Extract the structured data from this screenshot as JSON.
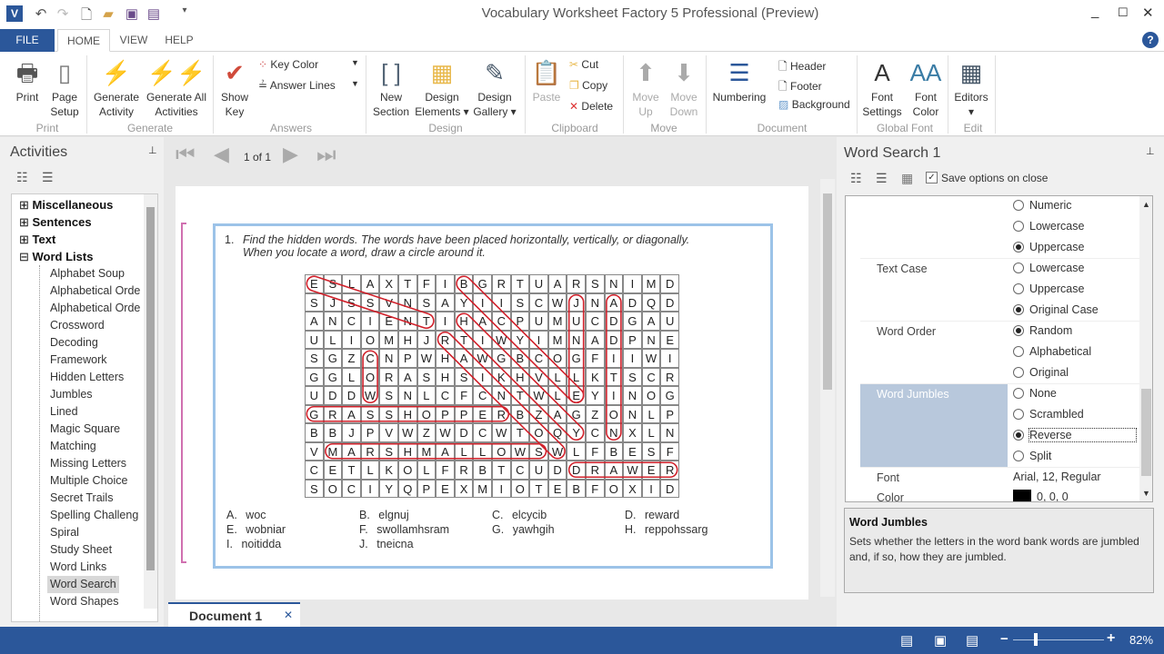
{
  "app": {
    "title": "Vocabulary Worksheet Factory 5 Professional (Preview)",
    "logo": "V"
  },
  "quick_access": [
    "undo-icon",
    "redo-icon",
    "new-icon",
    "open-icon",
    "save-icon",
    "save-as-icon",
    "customize-icon"
  ],
  "tabs": [
    {
      "label": "FILE"
    },
    {
      "label": "HOME",
      "active": true
    },
    {
      "label": "VIEW"
    },
    {
      "label": "HELP"
    }
  ],
  "ribbon": {
    "print": {
      "label": "Print",
      "group": "Print",
      "page_setup": "Page Setup"
    },
    "generate": {
      "activity": "Generate Activity",
      "all": "Generate All Activities",
      "group": "Generate"
    },
    "answers": {
      "show_key": "Show Key",
      "key_color": "Key Color",
      "answer_lines": "Answer Lines",
      "group": "Answers"
    },
    "design": {
      "new_section": "New Section",
      "elements": "Design Elements",
      "gallery": "Design Gallery",
      "group": "Design"
    },
    "clipboard": {
      "paste": "Paste",
      "cut": "Cut",
      "copy": "Copy",
      "delete": "Delete",
      "group": "Clipboard"
    },
    "move": {
      "up": "Move Up",
      "down": "Move Down",
      "group": "Move"
    },
    "document": {
      "numbering": "Numbering",
      "header": "Header",
      "footer": "Footer",
      "background": "Background",
      "group": "Document"
    },
    "font": {
      "settings": "Font Settings",
      "color": "Font Color",
      "group": "Global Font"
    },
    "edit": {
      "editors": "Editors",
      "group": "Edit"
    }
  },
  "activities": {
    "title": "Activities",
    "categories": [
      "Miscellaneous",
      "Sentences",
      "Text",
      "Word Lists"
    ],
    "items": [
      "Alphabet Soup",
      "Alphabetical Orde",
      "Alphabetical Orde",
      "Crossword",
      "Decoding",
      "Framework",
      "Hidden Letters",
      "Jumbles",
      "Lined",
      "Magic Square",
      "Matching",
      "Missing Letters",
      "Multiple Choice",
      "Secret Trails",
      "Spelling Challeng",
      "Spiral",
      "Study Sheet",
      "Word Links",
      "Word Search",
      "Word Shapes"
    ],
    "selected": "Word Search"
  },
  "nav": {
    "page": "1 of 1"
  },
  "document_tab": "Document 1",
  "worksheet": {
    "number": "1.",
    "instructions": "Find the hidden words. The words have been placed horizontally, vertically, or diagonally. When you locate a word, draw a circle around it.",
    "grid": [
      "ESLAXTFIBGRTUARSNIMD",
      "SJSSVNSAYIISCWJNADQD",
      "ANCIENTIHACPUMUCDGAU",
      "ULIOMHJRTIWYIMNADPNE",
      "SGZCNPWHAWGBCOGFIIWI",
      "GGLORASHSIKHVLLKTSCR",
      "UDDWSNLCFCNTWLEYINOG",
      "GRASSHOPPERBZAGZONLP",
      "BBJPVWZWDCWTOQYCNXLN",
      "VMARSHMALLOWSWLFBESF",
      "CETLKOLFRBTCUDDRAWER",
      "SOCIYQPEXMIOTEBFOXID"
    ],
    "answer_key_color": "#d0202a",
    "answers": [
      {
        "word": "ANCIENT",
        "start": [
          1,
          1
        ],
        "end": [
          3,
          7
        ]
      },
      {
        "word": "GRASSHOPPER",
        "start": [
          8,
          1
        ],
        "end": [
          8,
          11
        ]
      },
      {
        "word": "MARSHMALLOWS",
        "start": [
          10,
          2
        ],
        "end": [
          10,
          13
        ]
      },
      {
        "word": "DRAWER",
        "start": [
          11,
          15
        ],
        "end": [
          11,
          20
        ]
      },
      {
        "word": "COW",
        "start": [
          5,
          4
        ],
        "end": [
          7,
          4
        ]
      },
      {
        "word": "JUNGLE",
        "start": [
          2,
          15
        ],
        "end": [
          7,
          15
        ]
      },
      {
        "word": "ADDITION",
        "start": [
          2,
          17
        ],
        "end": [
          9,
          17
        ]
      },
      {
        "word": "BICYCLE",
        "start": [
          1,
          9
        ],
        "end": [
          7,
          15
        ]
      },
      {
        "word": "HIGHWAY",
        "start": [
          3,
          9
        ],
        "end": [
          9,
          15
        ]
      },
      {
        "word": "RAINBOW",
        "start": [
          4,
          8
        ],
        "end": [
          10,
          14
        ]
      }
    ],
    "word_bank": [
      [
        "A.",
        "woc"
      ],
      [
        "B.",
        "elgnuj"
      ],
      [
        "C.",
        "elcycib"
      ],
      [
        "D.",
        "reward"
      ],
      [
        "E.",
        "wobniar"
      ],
      [
        "F.",
        "swollamhsram"
      ],
      [
        "G.",
        "yawhgih"
      ],
      [
        "H.",
        "reppohssarg"
      ],
      [
        "I.",
        "noitidda"
      ],
      [
        "J.",
        "tneicna"
      ]
    ]
  },
  "properties": {
    "title": "Word Search 1",
    "save_on_close": "Save options on close",
    "save_checked": true,
    "rows": [
      {
        "label": "",
        "options": [
          {
            "t": "Numeric"
          },
          {
            "t": "Lowercase"
          },
          {
            "t": "Uppercase",
            "on": true
          }
        ]
      },
      {
        "label": "Text Case",
        "options": [
          {
            "t": "Lowercase"
          },
          {
            "t": "Uppercase"
          },
          {
            "t": "Original Case",
            "on": true
          }
        ]
      },
      {
        "label": "Word Order",
        "options": [
          {
            "t": "Random",
            "on": true
          },
          {
            "t": "Alphabetical"
          },
          {
            "t": "Original"
          }
        ]
      },
      {
        "label": "Word Jumbles",
        "selected": true,
        "options": [
          {
            "t": "None"
          },
          {
            "t": "Scrambled"
          },
          {
            "t": "Reverse",
            "on": true
          },
          {
            "t": "Split"
          }
        ]
      }
    ],
    "font_label": "Font",
    "font_value": "Arial, 12, Regular",
    "color_label": "Color",
    "color_value": "0, 0, 0",
    "help_title": "Word Jumbles",
    "help_text": "Sets whether the letters in the word bank words are jumbled and, if so, how they are jumbled."
  },
  "status": {
    "zoom": "82%",
    "zoom_percent": 82
  },
  "colors": {
    "accent": "#2b579a",
    "selection": "#b8c8dc",
    "page_border": "#9cc3e8"
  }
}
